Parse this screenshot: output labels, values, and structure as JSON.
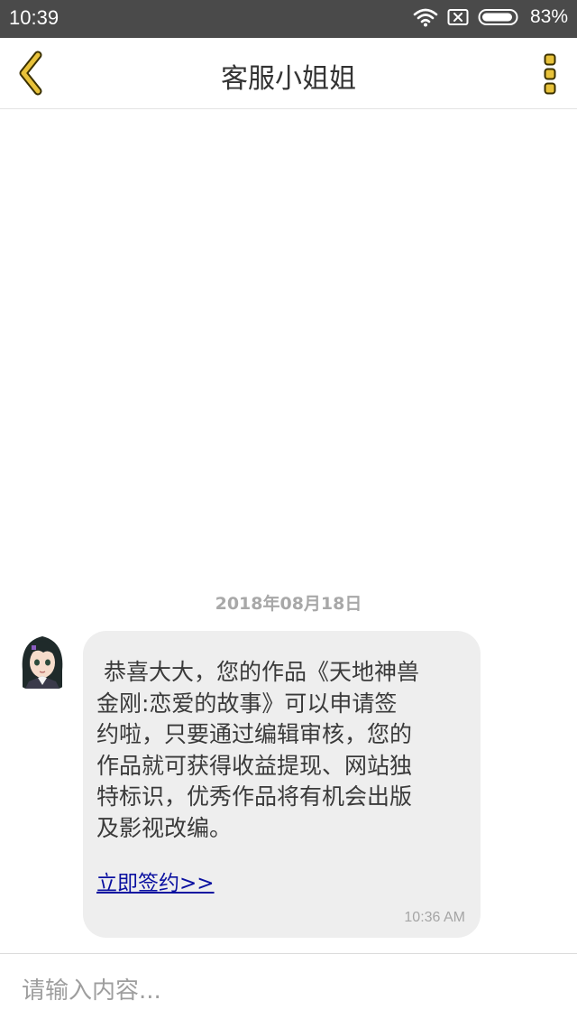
{
  "status_bar": {
    "time": "10:39",
    "battery_percent": "83%"
  },
  "header": {
    "title": "客服小姐姐"
  },
  "chat": {
    "date": "2018年08月18日",
    "message": {
      "text": " 恭喜大大，您的作品《天地神兽\n金刚:恋爱的故事》可以申请签\n约啦，只要通过编辑审核，您的\n作品就可获得收益提现、网站独\n特标识，优秀作品将有机会出版\n及影视改编。",
      "link": "立即签约>>",
      "time": "10:36 AM"
    }
  },
  "input": {
    "placeholder": "请输入内容..."
  },
  "colors": {
    "accent": "#e8c23a",
    "bubble": "#eeeeee",
    "link": "#0a10a0",
    "status_bar": "#4a4a4a"
  },
  "icons": {
    "back": "chevron-left-icon",
    "menu": "vertical-dots-icon",
    "wifi": "wifi-icon",
    "sim": "no-sim-icon",
    "battery": "battery-icon"
  }
}
